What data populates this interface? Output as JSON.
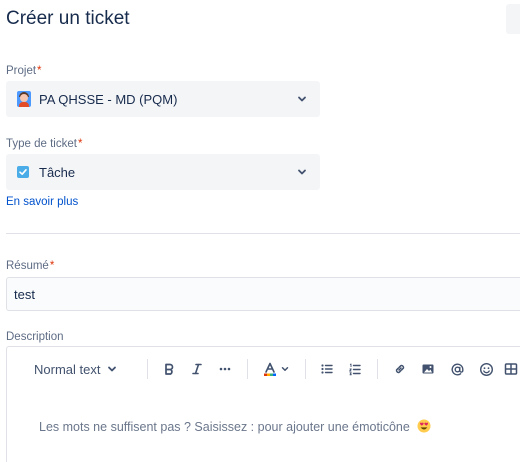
{
  "dialog": {
    "title": "Créer un ticket"
  },
  "project": {
    "label": "Projet",
    "required_mark": "*",
    "value": "PA QHSSE - MD (PQM)",
    "icon": "project-avatar-icon"
  },
  "issue_type": {
    "label": "Type de ticket",
    "required_mark": "*",
    "value": "Tâche",
    "icon": "task-checkbox-icon",
    "learn_more": "En savoir plus"
  },
  "summary": {
    "label": "Résumé",
    "required_mark": "*",
    "value": "test"
  },
  "description": {
    "label": "Description",
    "toolbar": {
      "text_style": "Normal text",
      "items": [
        "bold-icon",
        "italic-icon",
        "more-formatting-icon",
        "text-color-icon",
        "bullet-list-icon",
        "numbered-list-icon",
        "link-icon",
        "image-icon",
        "mention-icon",
        "emoji-icon",
        "table-icon"
      ]
    },
    "placeholder": "Les mots ne suffisent pas ? Saisissez : pour ajouter une émoticône",
    "placeholder_emoji": "😍"
  },
  "colors": {
    "link": "#0052cc",
    "required": "#de350b",
    "task_icon": "#4bade8",
    "field_bg": "#f4f5f7"
  }
}
